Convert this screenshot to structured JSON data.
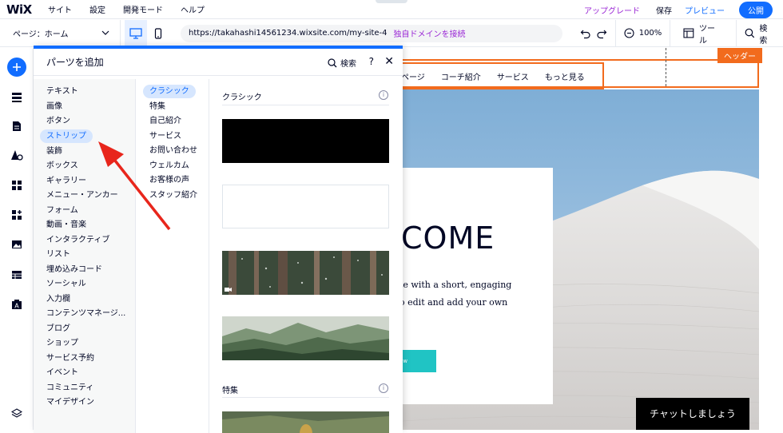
{
  "topbar": {
    "logo": "WiX",
    "menu": [
      "サイト",
      "設定",
      "開発モード",
      "ヘルプ"
    ],
    "upgrade": "アップグレード",
    "save": "保存",
    "preview": "プレビュー",
    "publish": "公開"
  },
  "toolbar": {
    "page_label": "ページ：ホーム",
    "url": "https://takahashi14561234.wixsite.com/my-site-4",
    "url_domain_link": "独自ドメインを接続",
    "zoom": "100%",
    "tools": "ツール",
    "search": "検索"
  },
  "rail": {
    "icons": [
      "add-icon",
      "menus-pages-icon",
      "blog-icon",
      "design-icon",
      "apps-icon",
      "app-market-icon",
      "media-icon",
      "table-icon",
      "cms-icon",
      "layers-icon"
    ]
  },
  "panel": {
    "title": "パーツを追加",
    "search": "検索",
    "help": "?",
    "close": "✕",
    "categories": [
      "テキスト",
      "画像",
      "ボタン",
      "ストリップ",
      "装飾",
      "ボックス",
      "ギャラリー",
      "メニュー・アンカー",
      "フォーム",
      "動画・音楽",
      "インタラクティブ",
      "リスト",
      "埋め込みコード",
      "ソーシャル",
      "入力欄",
      "コンテンツマネージ...",
      "ブログ",
      "ショップ",
      "サービス予約",
      "イベント",
      "コミュニティ",
      "マイデザイン"
    ],
    "selected_category": "ストリップ",
    "subcategories": [
      "クラシック",
      "特集",
      "自己紹介",
      "サービス",
      "お問い合わせ",
      "ウェルカム",
      "お客様の声",
      "スタッフ紹介"
    ],
    "selected_subcategory": "クラシック",
    "section_classic": "クラシック",
    "section_feature": "特集",
    "info": "i"
  },
  "canvas": {
    "nav_items": [
      "ページ",
      "コーチ紹介",
      "サービス",
      "もっと見る"
    ],
    "header_tag": "ヘッダー",
    "hero_title": "COME",
    "hero_lines": [
      "te with a short, engaging",
      "o edit and add your own",
      "."
    ],
    "hero_button": "ow",
    "chat_button": "チャットしましょう"
  },
  "colors": {
    "accent": "#116dff",
    "upgrade": "#9a27d5",
    "header_orange": "#f26b1d",
    "arrow_red": "#e8261c",
    "teal_button": "#20c4c4"
  }
}
